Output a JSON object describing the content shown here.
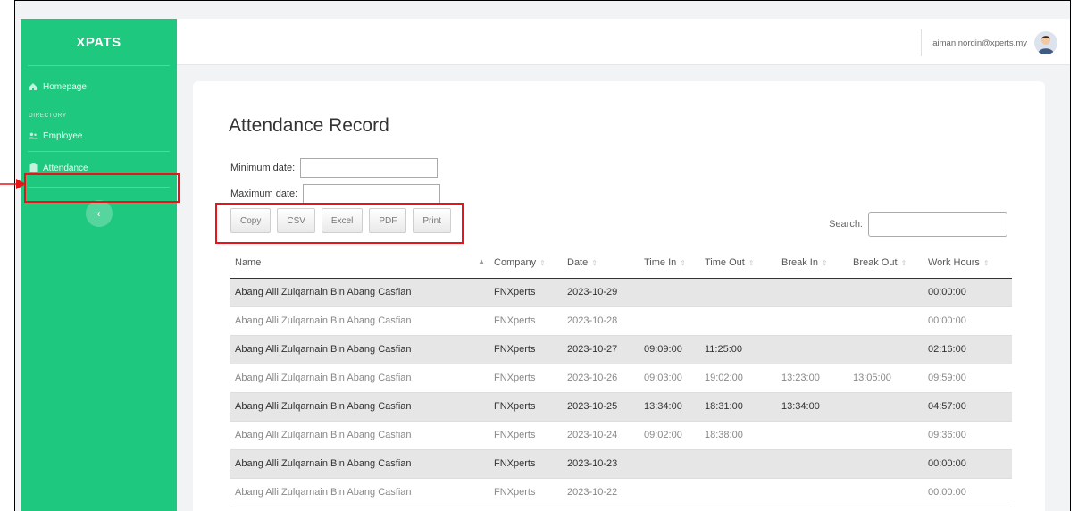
{
  "brand": {
    "name": "XPATS"
  },
  "sidebar": {
    "items": [
      {
        "label": "Homepage",
        "icon": "home-icon"
      },
      {
        "label": "Employee",
        "icon": "users-icon"
      },
      {
        "label": "Attendance",
        "icon": "clipboard-icon"
      }
    ],
    "section": "DIRECTORY",
    "toggle_icon": "‹"
  },
  "topbar": {
    "user_email": "aiman.nordin@xperts.my"
  },
  "page": {
    "title": "Attendance Record",
    "min_date_label": "Minimum date:",
    "max_date_label": "Maximum date:",
    "min_date_value": "",
    "max_date_value": "",
    "search_label": "Search:",
    "search_value": ""
  },
  "buttons": [
    "Copy",
    "CSV",
    "Excel",
    "PDF",
    "Print"
  ],
  "table": {
    "columns": [
      "Name",
      "Company",
      "Date",
      "Time In",
      "Time Out",
      "Break In",
      "Break Out",
      "Work Hours"
    ],
    "rows": [
      [
        "Abang Alli Zulqarnain Bin Abang Casfian",
        "FNXperts",
        "2023-10-29",
        "",
        "",
        "",
        "",
        "00:00:00"
      ],
      [
        "Abang Alli Zulqarnain Bin Abang Casfian",
        "FNXperts",
        "2023-10-28",
        "",
        "",
        "",
        "",
        "00:00:00"
      ],
      [
        "Abang Alli Zulqarnain Bin Abang Casfian",
        "FNXperts",
        "2023-10-27",
        "09:09:00",
        "11:25:00",
        "",
        "",
        "02:16:00"
      ],
      [
        "Abang Alli Zulqarnain Bin Abang Casfian",
        "FNXperts",
        "2023-10-26",
        "09:03:00",
        "19:02:00",
        "13:23:00",
        "13:05:00",
        "09:59:00"
      ],
      [
        "Abang Alli Zulqarnain Bin Abang Casfian",
        "FNXperts",
        "2023-10-25",
        "13:34:00",
        "18:31:00",
        "13:34:00",
        "",
        "04:57:00"
      ],
      [
        "Abang Alli Zulqarnain Bin Abang Casfian",
        "FNXperts",
        "2023-10-24",
        "09:02:00",
        "18:38:00",
        "",
        "",
        "09:36:00"
      ],
      [
        "Abang Alli Zulqarnain Bin Abang Casfian",
        "FNXperts",
        "2023-10-23",
        "",
        "",
        "",
        "",
        "00:00:00"
      ],
      [
        "Abang Alli Zulqarnain Bin Abang Casfian",
        "FNXperts",
        "2023-10-22",
        "",
        "",
        "",
        "",
        "00:00:00"
      ]
    ]
  },
  "colors": {
    "sidebar": "#1ec87e",
    "highlight": "#e8141a"
  }
}
